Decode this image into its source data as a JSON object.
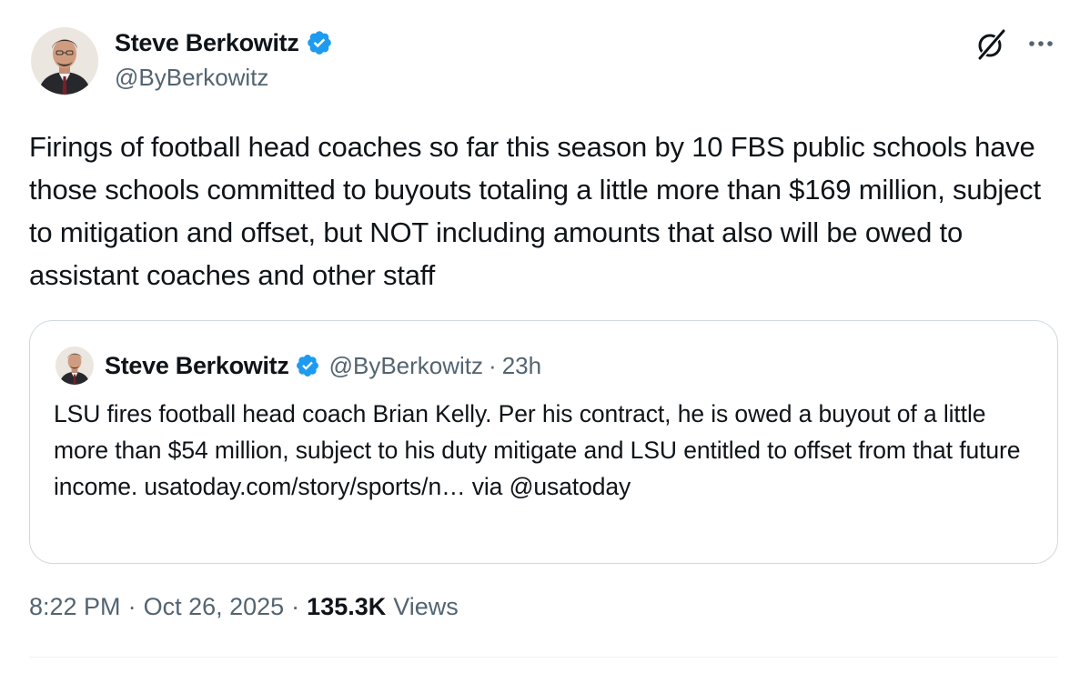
{
  "author": {
    "name": "Steve Berkowitz",
    "handle": "@ByBerkowitz"
  },
  "tweet": {
    "text": "Firings of football head coaches so far this season by 10 FBS public schools have those schools committed to buyouts totaling a little more than $169 million, subject to mitigation and offset, but NOT including amounts that also will be owed to assistant coaches and other staff"
  },
  "quote": {
    "name": "Steve Berkowitz",
    "handle": "@ByBerkowitz",
    "dot": "·",
    "time": "23h",
    "text": "LSU fires football head coach Brian Kelly. Per his contract, he is owed a buyout of a little more than $54 million, subject to his duty mitigate and LSU entitled to offset from that future income. usatoday.com/story/sports/n… via @usatoday"
  },
  "meta": {
    "time": "8:22 PM",
    "sep": "·",
    "date": "Oct 26, 2025",
    "views_count": "135.3K",
    "views_label": "Views"
  },
  "icons": {
    "verified": "verified-badge-icon",
    "grok": "grok-icon",
    "more": "more-icon"
  },
  "colors": {
    "verified_blue": "#1d9bf0",
    "secondary_text": "#536471",
    "primary_text": "#0f1419",
    "border": "#cfd9de"
  }
}
